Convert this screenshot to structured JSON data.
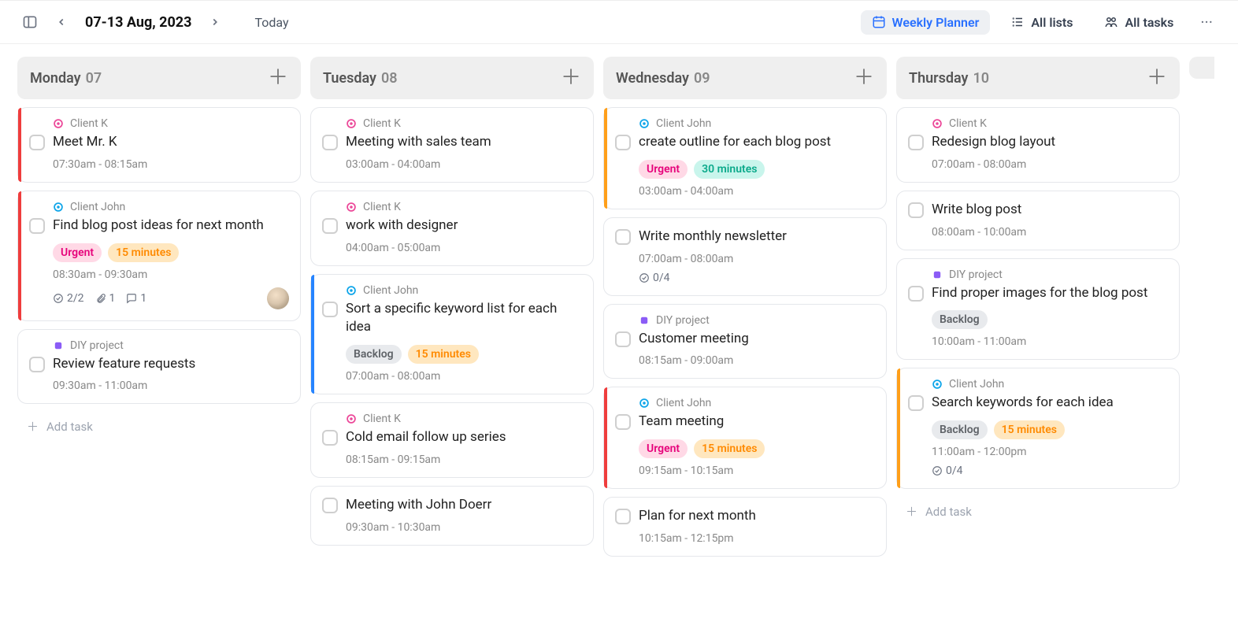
{
  "header": {
    "date_range": "07-13 Aug, 2023",
    "today_label": "Today",
    "weekly_planner": "Weekly Planner",
    "all_lists": "All lists",
    "all_tasks": "All tasks"
  },
  "categories": {
    "clientK": {
      "label": "Client K",
      "icon": "target-pink"
    },
    "clientJohn": {
      "label": "Client John",
      "icon": "target-blue"
    },
    "diy": {
      "label": "DIY project",
      "icon": "square-purple"
    }
  },
  "tags": {
    "urgent": "Urgent",
    "backlog": "Backlog",
    "m15": "15 minutes",
    "m30": "30 minutes"
  },
  "add_task_label": "Add task",
  "columns": [
    {
      "day": "Monday",
      "num": "07",
      "tasks": [
        {
          "cat": "clientK",
          "stripe": "red",
          "title": "Meet Mr. K",
          "time": "07:30am - 08:15am"
        },
        {
          "cat": "clientJohn",
          "stripe": "red",
          "title": "Find blog post ideas for next month",
          "tags": [
            "urgent",
            "m15"
          ],
          "time": "08:30am - 09:30am",
          "subtasks": "2/2",
          "attachments": "1",
          "comments": "1",
          "avatar": true
        },
        {
          "cat": "diy",
          "title": "Review feature requests",
          "time": "09:30am - 11:00am"
        }
      ],
      "show_add": true
    },
    {
      "day": "Tuesday",
      "num": "08",
      "tasks": [
        {
          "cat": "clientK",
          "title": "Meeting with sales team",
          "time": "03:00am - 04:00am"
        },
        {
          "cat": "clientK",
          "title": "work with designer",
          "time": "04:00am - 05:00am"
        },
        {
          "cat": "clientJohn",
          "stripe": "blue",
          "title": "Sort a specific keyword list for each idea",
          "tags": [
            "backlog",
            "m15"
          ],
          "time": "07:00am - 08:00am"
        },
        {
          "cat": "clientK",
          "title": "Cold email follow up series",
          "time": "08:15am - 09:15am"
        },
        {
          "no_cat": true,
          "title": "Meeting with John Doerr",
          "time": "09:30am - 10:30am"
        }
      ]
    },
    {
      "day": "Wednesday",
      "num": "09",
      "tasks": [
        {
          "cat": "clientJohn",
          "stripe": "orange",
          "title": "create outline for each blog post",
          "tags": [
            "urgent",
            "m30"
          ],
          "time": "03:00am - 04:00am"
        },
        {
          "no_cat": true,
          "title": "Write monthly newsletter",
          "time": "07:00am - 08:00am",
          "subtasks": "0/4"
        },
        {
          "cat": "diy",
          "title": "Customer meeting",
          "time": "08:15am - 09:00am"
        },
        {
          "cat": "clientJohn",
          "stripe": "red",
          "title": "Team meeting",
          "tags": [
            "urgent",
            "m15"
          ],
          "time": "09:15am - 10:15am"
        },
        {
          "no_cat": true,
          "title": "Plan for next month",
          "time": "10:15am - 12:15pm"
        }
      ]
    },
    {
      "day": "Thursday",
      "num": "10",
      "tasks": [
        {
          "cat": "clientK",
          "title": "Redesign blog layout",
          "time": "07:00am - 08:00am"
        },
        {
          "no_cat": true,
          "title": "Write blog post",
          "time": "08:00am - 10:00am"
        },
        {
          "cat": "diy",
          "title": "Find proper images for the blog post",
          "tags": [
            "backlog"
          ],
          "time": "10:00am - 11:00am"
        },
        {
          "cat": "clientJohn",
          "stripe": "orange",
          "title": "Search keywords for each idea",
          "tags": [
            "backlog",
            "m15"
          ],
          "time": "11:00am - 12:00pm",
          "subtasks": "0/4"
        }
      ],
      "show_add": true
    }
  ]
}
